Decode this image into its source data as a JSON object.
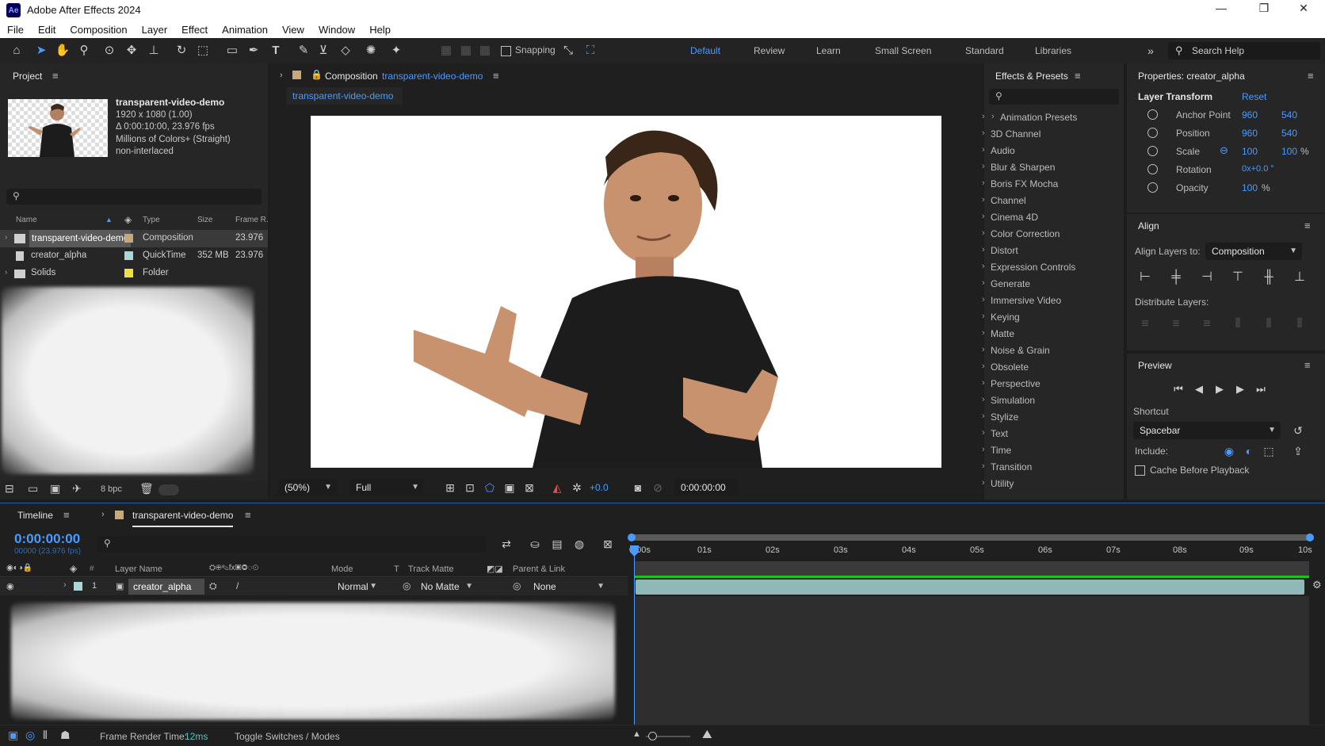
{
  "app": {
    "title": "Adobe After Effects 2024",
    "logo": "Ae",
    "window_controls": [
      "minimize-icon",
      "maximize-icon",
      "close-icon"
    ]
  },
  "menu": [
    "File",
    "Edit",
    "Composition",
    "Layer",
    "Effect",
    "Animation",
    "View",
    "Window",
    "Help"
  ],
  "toolbar": {
    "snapping_label": "Snapping",
    "workspaces": [
      "Default",
      "Review",
      "Learn",
      "Small Screen",
      "Standard",
      "Libraries"
    ],
    "active_workspace": "Default",
    "search_help": "Search Help"
  },
  "project": {
    "panel_title": "Project",
    "item_name": "transparent-video-demo",
    "info": [
      "1920 x 1080 (1.00)",
      "Δ 0:00:10:00, 23.976 fps",
      "Millions of Colors+ (Straight)",
      "non-interlaced"
    ],
    "columns": {
      "name": "Name",
      "type": "Type",
      "size": "Size",
      "frame_rate": "Frame R."
    },
    "rows": [
      {
        "name": "transparent-video-demo",
        "type": "Composition",
        "size": "",
        "fps": "23.976",
        "color": "#c8a878"
      },
      {
        "name": "creator_alpha",
        "type": "QuickTime",
        "size": "352 MB",
        "fps": "23.976",
        "color": "#a8d8d8"
      },
      {
        "name": "Solids",
        "type": "Folder",
        "size": "",
        "fps": "",
        "color": "#f0e040"
      }
    ],
    "bpc": "8 bpc"
  },
  "composition": {
    "header_label": "Composition",
    "comp_name": "transparent-video-demo",
    "tab": "transparent-video-demo",
    "zoom": "(50%)",
    "resolution": "Full",
    "exposure": "+0.0",
    "timecode": "0:00:00:00"
  },
  "effects": {
    "panel_title": "Effects & Presets",
    "items": [
      "Animation Presets",
      "3D Channel",
      "Audio",
      "Blur & Sharpen",
      "Boris FX Mocha",
      "Channel",
      "Cinema 4D",
      "Color Correction",
      "Distort",
      "Expression Controls",
      "Generate",
      "Immersive Video",
      "Keying",
      "Matte",
      "Noise & Grain",
      "Obsolete",
      "Perspective",
      "Simulation",
      "Stylize",
      "Text",
      "Time",
      "Transition",
      "Utility"
    ]
  },
  "properties": {
    "panel_title": "Properties: creator_alpha",
    "section": "Layer Transform",
    "reset": "Reset",
    "anchor_label": "Anchor Point",
    "anchor_x": "960",
    "anchor_y": "540",
    "position_label": "Position",
    "position_x": "960",
    "position_y": "540",
    "scale_label": "Scale",
    "scale_x": "100",
    "scale_y": "100",
    "scale_unit": "%",
    "rotation_label": "Rotation",
    "rotation_val": "0x+0.0 °",
    "opacity_label": "Opacity",
    "opacity_val": "100",
    "opacity_unit": "%"
  },
  "align": {
    "panel_title": "Align",
    "align_to_label": "Align Layers to:",
    "align_to_value": "Composition",
    "distribute_label": "Distribute Layers:"
  },
  "preview": {
    "panel_title": "Preview",
    "shortcut_label": "Shortcut",
    "shortcut_value": "Spacebar",
    "include_label": "Include:",
    "cache_label": "Cache Before Playback"
  },
  "timeline": {
    "panel_title": "Timeline",
    "comp_tab": "transparent-video-demo",
    "timecode": "0:00:00:00",
    "frame_info": "00000 (23.976 fps)",
    "columns": {
      "layer_name": "Layer Name",
      "mode": "Mode",
      "t": "T",
      "track_matte": "Track Matte",
      "parent": "Parent & Link"
    },
    "layer": {
      "index": "1",
      "name": "creator_alpha",
      "mode": "Normal",
      "matte": "No Matte",
      "parent": "None"
    },
    "ruler": [
      "0:00s",
      "01s",
      "02s",
      "03s",
      "04s",
      "05s",
      "06s",
      "07s",
      "08s",
      "09s",
      "10s"
    ],
    "frame_render_label": "Frame Render Time:",
    "frame_render_value": "12ms",
    "toggle_label": "Toggle Switches / Modes"
  },
  "colors": {
    "accent": "#4a9bff",
    "panel": "#262626",
    "background": "#1d1d1d",
    "track_bar": "#8fb8b8",
    "work_area": "#19c419"
  }
}
